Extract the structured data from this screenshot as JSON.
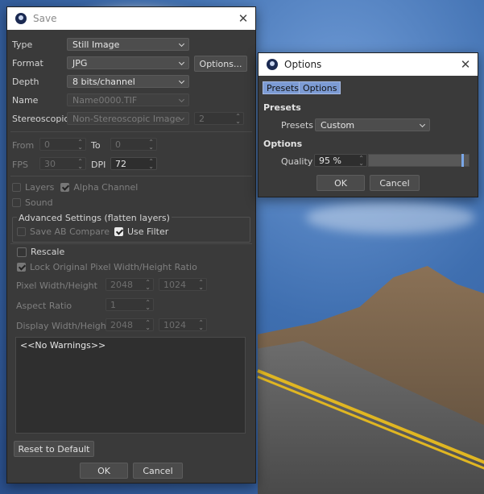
{
  "save": {
    "title": "Save",
    "type_label": "Type",
    "type_value": "Still Image",
    "format_label": "Format",
    "format_value": "JPG",
    "options_button": "Options...",
    "depth_label": "Depth",
    "depth_value": "8 bits/channel",
    "name_label": "Name",
    "name_value": "Name0000.TIF",
    "stereo_label": "Stereoscopic",
    "stereo_value": "Non-Stereoscopic Image",
    "stereo_num": "2",
    "from_label": "From",
    "from_value": "0",
    "to_label": "To",
    "to_value": "0",
    "fps_label": "FPS",
    "fps_value": "30",
    "dpi_label": "DPI",
    "dpi_value": "72",
    "layers_label": "Layers",
    "alpha_label": "Alpha Channel",
    "sound_label": "Sound",
    "advanced_label": "Advanced Settings (flatten layers)",
    "save_ab_label": "Save AB Compare",
    "use_filter_label": "Use Filter",
    "rescale_label": "Rescale",
    "lock_label": "Lock Original Pixel Width/Height Ratio",
    "pixel_wh_label": "Pixel Width/Height",
    "pixel_w": "2048",
    "pixel_h": "1024",
    "aspect_label": "Aspect Ratio",
    "aspect_value": "1",
    "display_wh_label": "Display Width/Height",
    "display_w": "2048",
    "display_h": "1024",
    "warnings_text": "<<No Warnings>>",
    "reset_button": "Reset to Default",
    "ok_button": "OK",
    "cancel_button": "Cancel"
  },
  "options": {
    "title": "Options",
    "tab_presets": "Presets",
    "tab_options": "Options",
    "presets_header": "Presets",
    "presets_label": "Presets",
    "presets_value": "Custom",
    "options_header": "Options",
    "quality_label": "Quality",
    "quality_value": "95 %",
    "quality_fraction": 0.95,
    "ok_button": "OK",
    "cancel_button": "Cancel"
  },
  "icons": [
    "app-logo-icon",
    "close-icon",
    "chevron-down-icon",
    "spinner-arrows-icon",
    "checkbox-icon"
  ],
  "colors": {
    "accent": "#7c9bd4",
    "dialog_bg": "#3a3a3a",
    "titlebar_bg": "#ffffff"
  }
}
